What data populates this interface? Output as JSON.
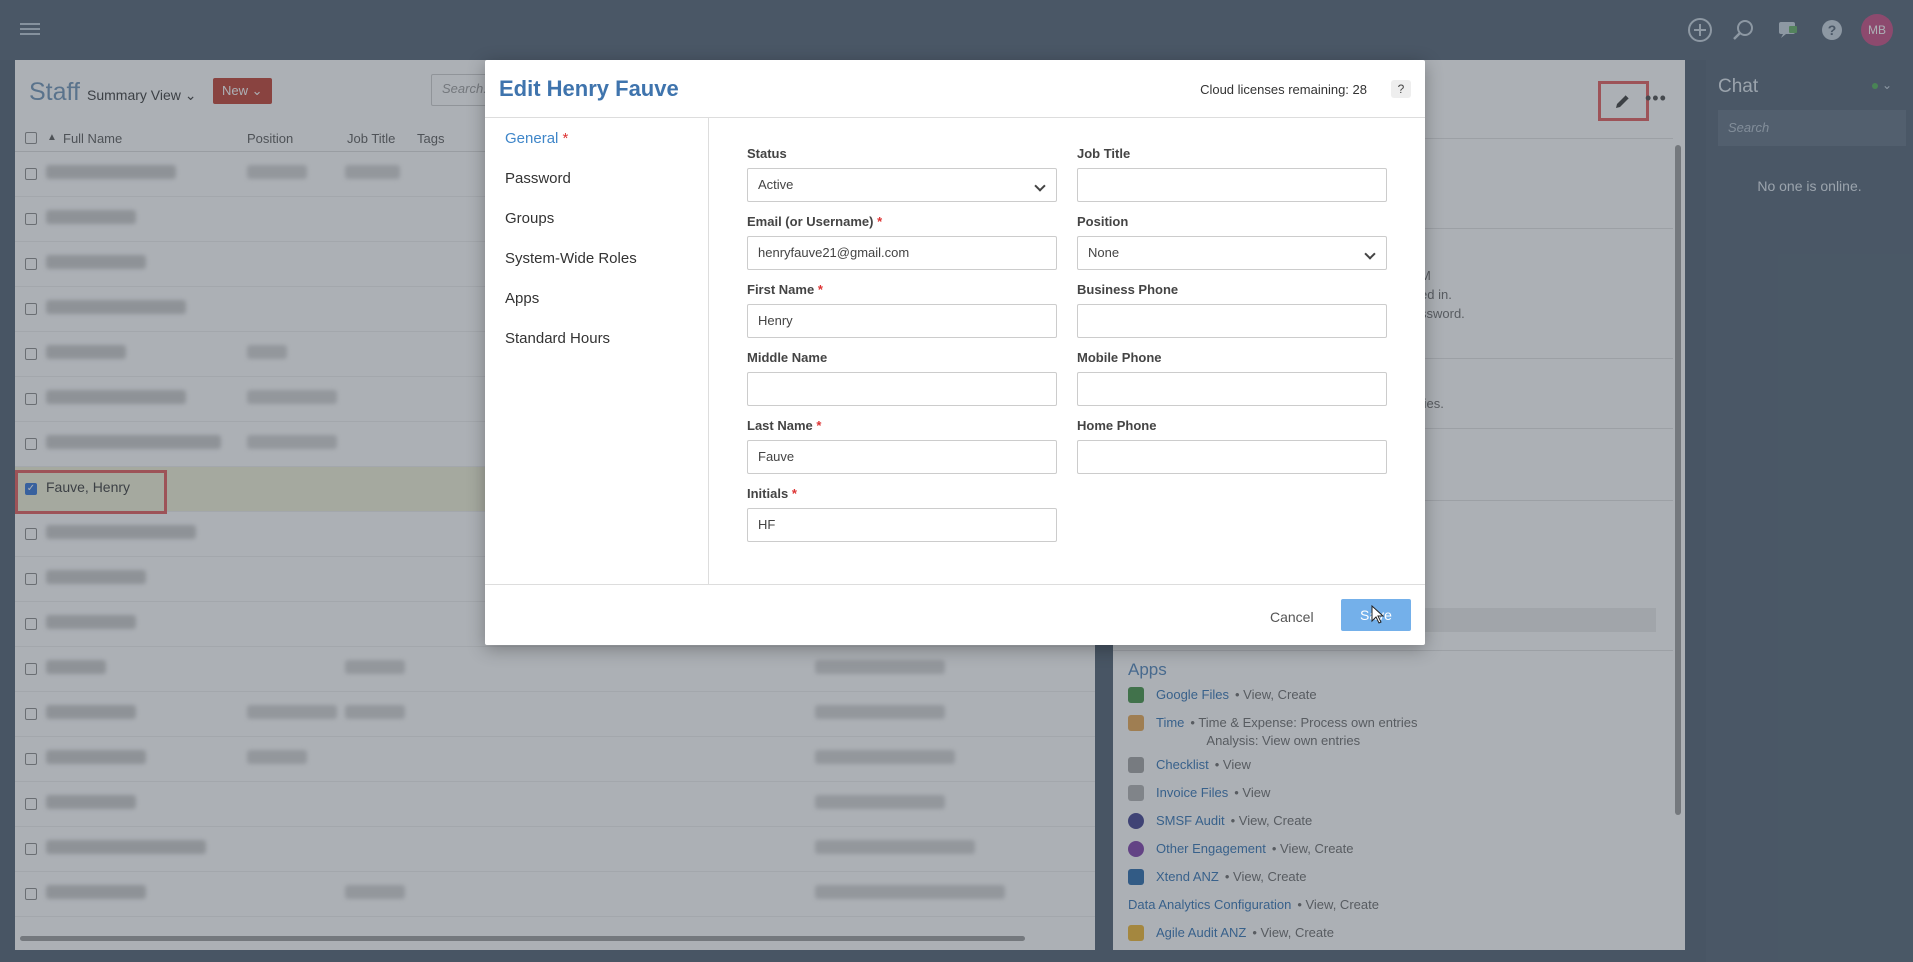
{
  "topbar": {
    "icons": [
      "menu-icon",
      "plus-circle-icon",
      "search-icon",
      "chat-bubble-icon",
      "help-icon"
    ],
    "avatar_initials": "MB"
  },
  "staff": {
    "title": "Staff",
    "view_label": "Summary View",
    "new_label": "New",
    "search_placeholder": "Search...",
    "columns": [
      "Full Name",
      "Position",
      "Job Title",
      "Tags"
    ],
    "selected_row_name": "Fauve, Henry"
  },
  "detail": {
    "text_1": "M",
    "text_2": "ed in.",
    "text_3": "ssword.",
    "text_4": "ties.",
    "apps_title": "Apps",
    "apps": [
      {
        "name": "Google Files",
        "perm": "• View, Create",
        "icon": "google-drive-icon",
        "color": "#3c8e3f"
      },
      {
        "name": "Time",
        "perm": "• Time & Expense: Process own entries",
        "perm2": "Analysis: View own entries",
        "icon": "time-icon",
        "color": "#e8a44b"
      },
      {
        "name": "Checklist",
        "perm": "• View",
        "icon": "checklist-icon",
        "color": "#9e9e9e"
      },
      {
        "name": "Invoice Files",
        "perm": "• View",
        "icon": "invoice-icon",
        "color": "#b0b0b0"
      },
      {
        "name": "SMSF Audit",
        "perm": "• View, Create",
        "icon": "smsf-audit-icon",
        "color": "#3a3a8a"
      },
      {
        "name": "Other Engagement",
        "perm": "• View, Create",
        "icon": "engagement-icon",
        "color": "#7b3aa8"
      },
      {
        "name": "Xtend ANZ",
        "perm": "• View, Create",
        "icon": "xtend-icon",
        "color": "#2165a8"
      },
      {
        "name": "Data Analytics Configuration",
        "perm": "• View, Create",
        "icon": "",
        "color": ""
      },
      {
        "name": "Agile Audit ANZ",
        "perm": "• View, Create",
        "icon": "agile-audit-icon",
        "color": "#f0b429"
      }
    ]
  },
  "chat": {
    "title": "Chat",
    "search_placeholder": "Search",
    "empty_text": "No one is online."
  },
  "modal": {
    "title": "Edit Henry Fauve",
    "licenses": "Cloud licenses remaining: 28",
    "help": "?",
    "nav": [
      {
        "label": "General",
        "required": "*"
      },
      {
        "label": "Password"
      },
      {
        "label": "Groups"
      },
      {
        "label": "System-Wide Roles"
      },
      {
        "label": "Apps"
      },
      {
        "label": "Standard Hours"
      }
    ],
    "fields": {
      "status": {
        "label": "Status",
        "value": "Active"
      },
      "email": {
        "label": "Email (or Username)",
        "req": "*",
        "value": "henryfauve21@gmail.com"
      },
      "first_name": {
        "label": "First Name",
        "req": "*",
        "value": "Henry"
      },
      "middle_name": {
        "label": "Middle Name",
        "value": ""
      },
      "last_name": {
        "label": "Last Name",
        "req": "*",
        "value": "Fauve"
      },
      "initials": {
        "label": "Initials",
        "req": "*",
        "value": "HF"
      },
      "job_title": {
        "label": "Job Title",
        "value": ""
      },
      "position": {
        "label": "Position",
        "value": "None"
      },
      "business_phone": {
        "label": "Business Phone",
        "value": ""
      },
      "mobile_phone": {
        "label": "Mobile Phone",
        "value": ""
      },
      "home_phone": {
        "label": "Home Phone",
        "value": ""
      }
    },
    "cancel_label": "Cancel",
    "save_label": "Save"
  }
}
